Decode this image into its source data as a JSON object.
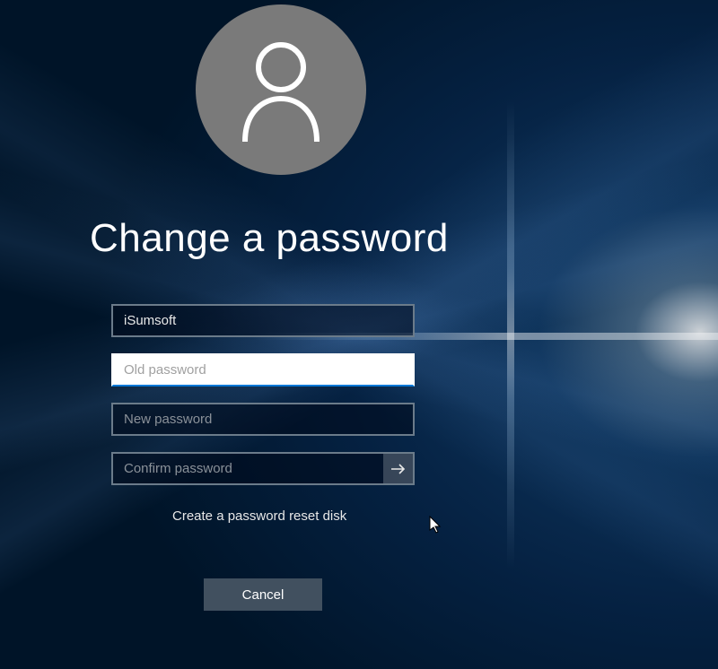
{
  "heading": "Change a password",
  "form": {
    "username_value": "iSumsoft",
    "old_password_placeholder": "Old password",
    "old_password_value": "",
    "new_password_placeholder": "New password",
    "new_password_value": "",
    "confirm_password_placeholder": "Confirm password",
    "confirm_password_value": ""
  },
  "reset_link_label": "Create a password reset disk",
  "cancel_button_label": "Cancel"
}
